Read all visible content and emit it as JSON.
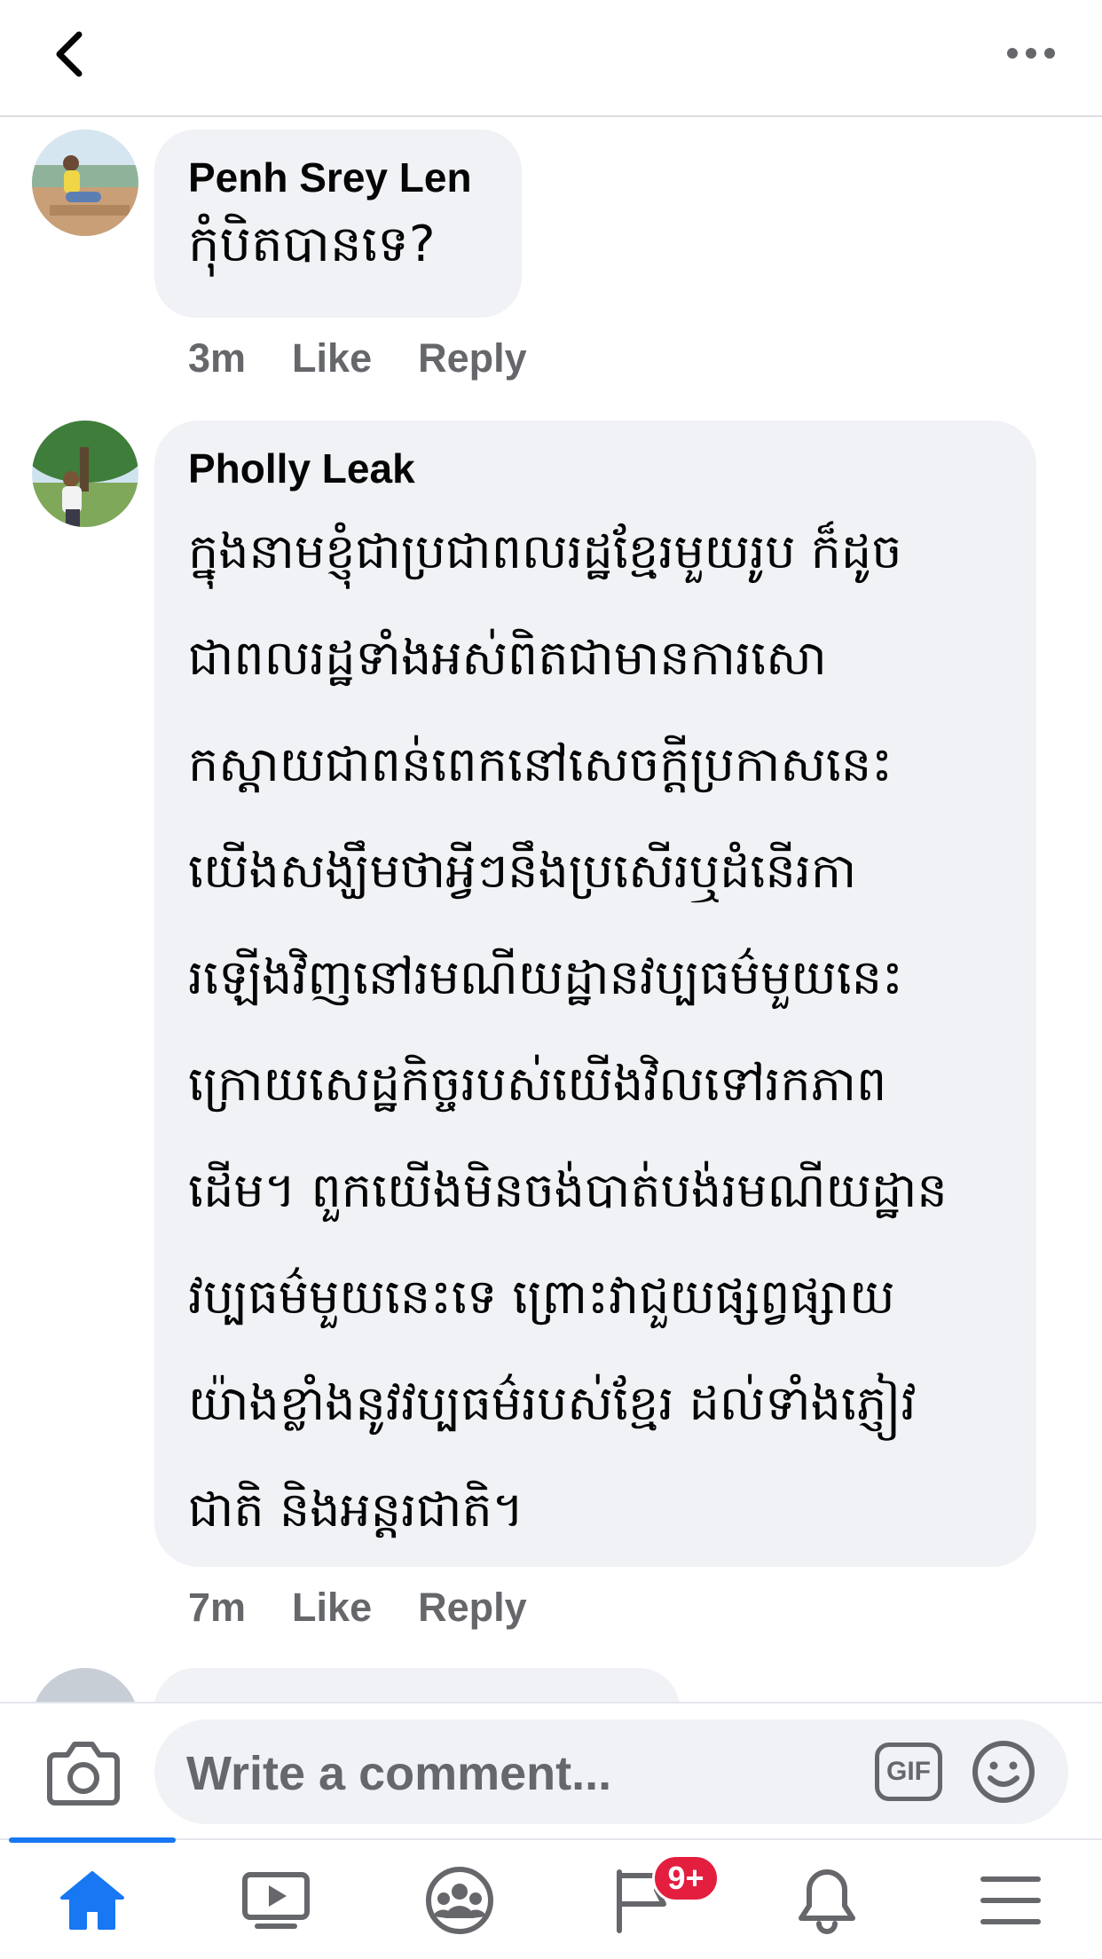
{
  "header": {
    "back_icon": "chevron-left-icon",
    "more_icon": "more-horizontal-icon"
  },
  "comments": [
    {
      "author": "Penh Srey Len",
      "lines": [
        "កុំបិតបានទេ?"
      ],
      "time": "3m",
      "like_label": "Like",
      "reply_label": "Reply"
    },
    {
      "author": "Pholly Leak",
      "lines": [
        "ក្នុងនាមខ្ញុំជាប្រជាពលរដ្ឋខ្មែរមួយរូប ក៏ដូច",
        "ជាពលរដ្ឋទាំងអស់ពិតជាមានការសោ",
        "កស្តាយជាពន់ពេកនៅសេចក្តីប្រកាសនេះ",
        "យើងសង្ឃឹមថាអ្វីៗនឹងប្រសើរឬដំនើរកា",
        "រឡើងវិញនៅរមណីយដ្ឋានវប្បធម៌មួយនេះ",
        "ក្រោយសេដ្ឋកិច្ចរបស់យើងវិលទៅរកភាព",
        "ដើម។ ពួកយើងមិនចង់បាត់បង់រមណីយដ្ឋាន",
        "វប្បធម៌មួយនេះទេ ព្រោះវាជួយផ្សព្វផ្សាយ",
        "យ៉ាងខ្លាំងនូវវប្បធម៌របស់ខ្មែរ ដល់ទាំងភ្ញៀវ",
        "ជាតិ និងអន្តរជាតិ។"
      ],
      "time": "7m",
      "like_label": "Like",
      "reply_label": "Reply"
    }
  ],
  "composer": {
    "camera_icon": "camera-icon",
    "placeholder": "Write a comment...",
    "gif_label": "GIF",
    "emoji_icon": "emoji-icon"
  },
  "tabbar": {
    "tabs": [
      "home-icon",
      "watch-icon",
      "groups-icon",
      "pages-icon",
      "notifications-icon",
      "menu-icon"
    ],
    "active": "home-icon",
    "pages_badge": "9+"
  },
  "colors": {
    "accent": "#1877f2",
    "bubble": "#f0f2f5",
    "secondary_text": "#65676b",
    "badge": "#e41e3f"
  }
}
